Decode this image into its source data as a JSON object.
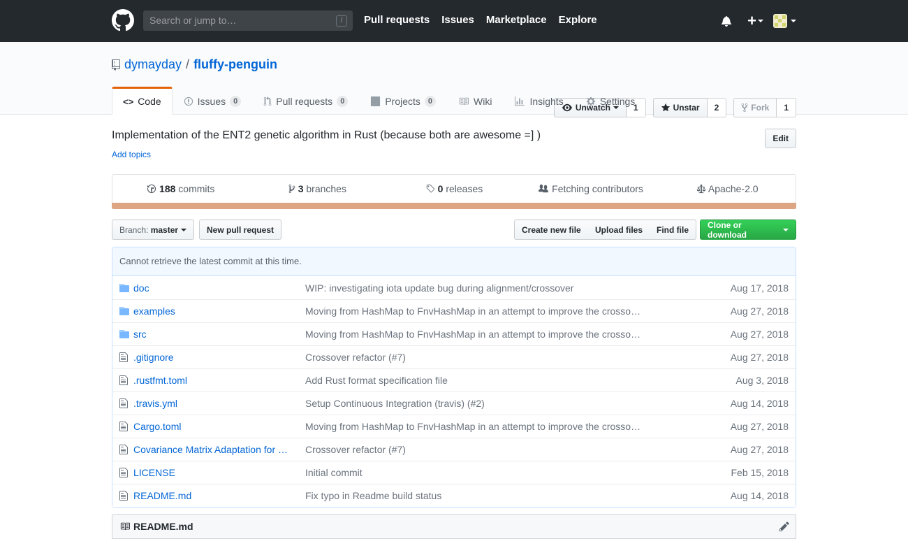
{
  "header": {
    "search_placeholder": "Search or jump to…",
    "search_shortcut": "/",
    "nav": [
      "Pull requests",
      "Issues",
      "Marketplace",
      "Explore"
    ],
    "plus_label": "+"
  },
  "repo": {
    "owner": "dymayday",
    "separator": "/",
    "name": "fluffy-penguin",
    "watch_label": "Unwatch",
    "watch_count": "1",
    "star_label": "Unstar",
    "star_count": "2",
    "fork_label": "Fork",
    "fork_count": "1"
  },
  "tabs": [
    {
      "label": "Code",
      "icon": "code-icon",
      "selected": true
    },
    {
      "label": "Issues",
      "count": "0",
      "icon": "issue-icon"
    },
    {
      "label": "Pull requests",
      "count": "0",
      "icon": "pull-request-icon"
    },
    {
      "label": "Projects",
      "count": "0",
      "icon": "project-icon"
    },
    {
      "label": "Wiki",
      "icon": "book-icon"
    },
    {
      "label": "Insights",
      "icon": "graph-icon"
    },
    {
      "label": "Settings",
      "icon": "gear-icon"
    }
  ],
  "description": "Implementation of the ENT2 genetic algorithm in Rust (because both are awesome =] )",
  "add_topics": "Add topics",
  "edit_label": "Edit",
  "summary": {
    "commits_count": "188",
    "commits_label": "commits",
    "branches_count": "3",
    "branches_label": "branches",
    "releases_count": "0",
    "releases_label": "releases",
    "contributors_label": "Fetching contributors",
    "license": "Apache-2.0",
    "language_color": "#dea584"
  },
  "file_nav": {
    "branch_prefix": "Branch:",
    "branch_name": "master",
    "new_pr": "New pull request",
    "create_file": "Create new file",
    "upload_files": "Upload files",
    "find_file": "Find file",
    "clone": "Clone or download"
  },
  "commit_tease": "Cannot retrieve the latest commit at this time.",
  "files": [
    {
      "type": "dir",
      "name": "doc",
      "message": "WIP: investigating iota update bug during alignment/crossover",
      "age": "Aug 17, 2018"
    },
    {
      "type": "dir",
      "name": "examples",
      "message": "Moving from HashMap to FnvHashMap in an attempt to improve the crosso…",
      "age": "Aug 27, 2018"
    },
    {
      "type": "dir",
      "name": "src",
      "message": "Moving from HashMap to FnvHashMap in an attempt to improve the crosso…",
      "age": "Aug 27, 2018"
    },
    {
      "type": "file",
      "name": ".gitignore",
      "message": "Crossover refactor (#7)",
      "age": "Aug 27, 2018"
    },
    {
      "type": "file",
      "name": ".rustfmt.toml",
      "message": "Add Rust format specification file",
      "age": "Aug 3, 2018"
    },
    {
      "type": "file",
      "name": ".travis.yml",
      "message": "Setup Continuous Integration (travis) (#2)",
      "age": "Aug 14, 2018"
    },
    {
      "type": "file",
      "name": "Cargo.toml",
      "message": "Moving from HashMap to FnvHashMap in an attempt to improve the crosso…",
      "age": "Aug 27, 2018"
    },
    {
      "type": "file",
      "name": "Covariance Matrix Adaptation for …",
      "message": "Crossover refactor (#7)",
      "age": "Aug 27, 2018"
    },
    {
      "type": "file",
      "name": "LICENSE",
      "message": "Initial commit",
      "age": "Feb 15, 2018"
    },
    {
      "type": "file",
      "name": "README.md",
      "message": "Fix typo in Readme build status",
      "age": "Aug 14, 2018"
    }
  ],
  "readme_title": "README.md"
}
